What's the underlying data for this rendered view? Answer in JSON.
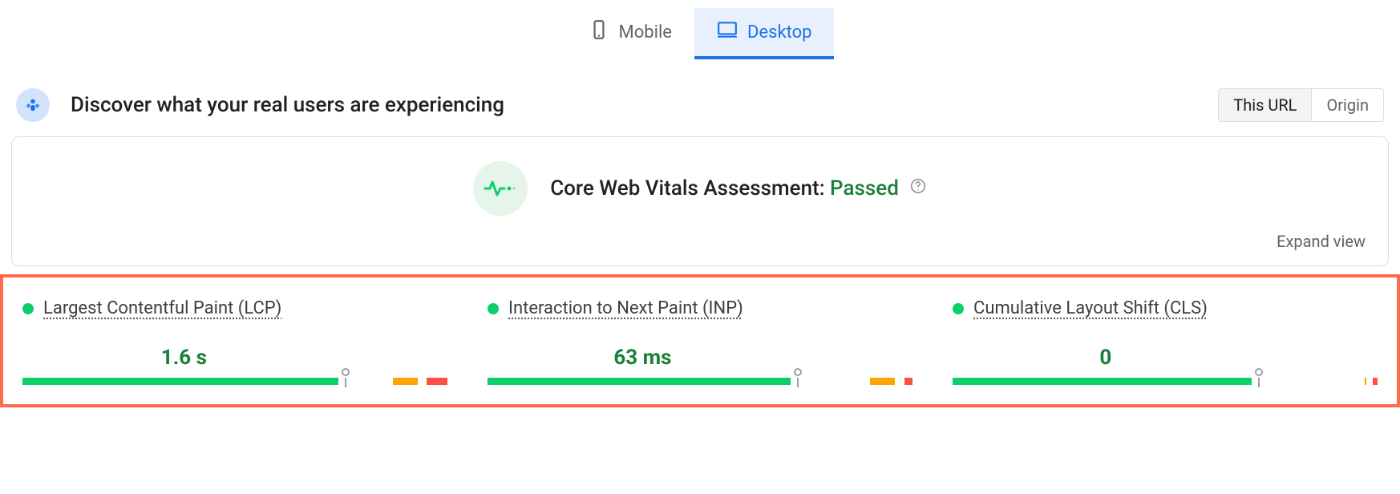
{
  "tabs": {
    "mobile": "Mobile",
    "desktop": "Desktop",
    "active": "desktop"
  },
  "header": {
    "title": "Discover what your real users are experiencing"
  },
  "toggle": {
    "this_url": "This URL",
    "origin": "Origin",
    "selected": "this_url"
  },
  "assessment": {
    "label": "Core Web Vitals Assessment: ",
    "status": "Passed"
  },
  "expand_label": "Expand view",
  "colors": {
    "good": "#0cce6b",
    "needs_improvement": "#ffa400",
    "poor": "#ff4e42",
    "pass_text": "#188038",
    "active_blue": "#1a73e8"
  },
  "metrics": [
    {
      "name": "Largest Contentful Paint (LCP)",
      "value": "1.6 s",
      "status": "good",
      "distribution": {
        "good": 76,
        "gap1": 12,
        "ni": 6,
        "gap2": 1,
        "poor": 5
      },
      "marker_pct": 76
    },
    {
      "name": "Interaction to Next Paint (INP)",
      "value": "63 ms",
      "status": "good",
      "distribution": {
        "good": 73,
        "gap1": 18,
        "ni": 6,
        "gap2": 1,
        "poor": 2
      },
      "marker_pct": 73
    },
    {
      "name": "Cumulative Layout Shift (CLS)",
      "value": "0",
      "status": "good",
      "distribution": {
        "good": 72,
        "gap1": 26,
        "ni": 0,
        "gap2": 0.5,
        "poor": 1.5
      },
      "marker_pct": 72
    }
  ]
}
